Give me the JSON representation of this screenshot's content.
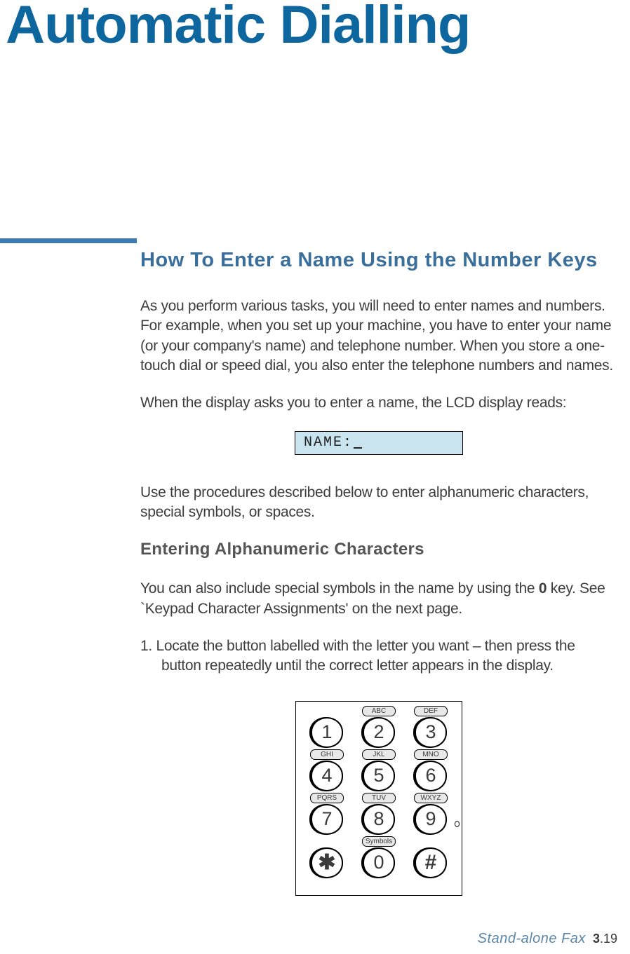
{
  "title": "Automatic Dialling",
  "section_heading": "How To Enter a Name Using the Number Keys",
  "para1": "As you perform various tasks, you will need to enter names and numbers. For example, when you set up your machine, you have to enter your name (or your company's name) and telephone number. When you store a one-touch dial or speed dial, you also enter the telephone numbers and names.",
  "para2": "When the display asks you to enter a name, the LCD display reads:",
  "lcd_text": "NAME:",
  "para3": "Use the procedures described below to enter alphanumeric characters, special symbols, or spaces.",
  "subsection_heading": "Entering Alphanumeric Characters",
  "para4_pre": "You can also include special symbols in the name by using the ",
  "para4_bold": "0",
  "para4_post": " key. See `Keypad Character Assignments' on the next page.",
  "step1": "1. Locate the button labelled with the letter you want – then press the button repeatedly until the correct letter appears in the display.",
  "keypad": {
    "rows": [
      [
        {
          "label": "",
          "digit": "1"
        },
        {
          "label": "ABC",
          "digit": "2"
        },
        {
          "label": "DEF",
          "digit": "3"
        }
      ],
      [
        {
          "label": "GHI",
          "digit": "4"
        },
        {
          "label": "JKL",
          "digit": "5"
        },
        {
          "label": "MNO",
          "digit": "6"
        }
      ],
      [
        {
          "label": "PQRS",
          "digit": "7"
        },
        {
          "label": "TUV",
          "digit": "8"
        },
        {
          "label": "WXYZ",
          "digit": "9"
        }
      ],
      [
        {
          "label": "",
          "digit": "✱"
        },
        {
          "label": "Symbols",
          "digit": "0"
        },
        {
          "label": "",
          "digit": "#"
        }
      ]
    ]
  },
  "footer": {
    "section": "Stand-alone Fax",
    "chapter": "3",
    "page": ".19"
  }
}
